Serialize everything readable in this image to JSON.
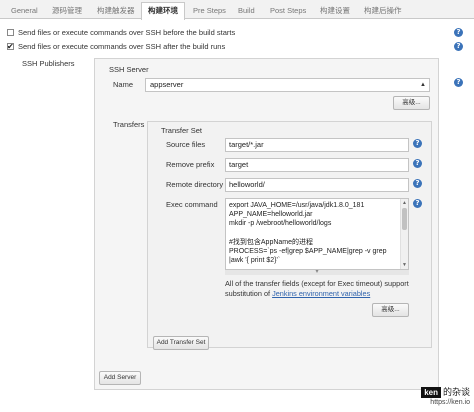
{
  "tabs": [
    "General",
    "源码管理",
    "构建触发器",
    "构建环境",
    "Pre Steps",
    "Build",
    "Post Steps",
    "构建设置",
    "构建后操作"
  ],
  "active_tab": "构建环境",
  "options": {
    "before_label": "Send files or execute commands over SSH before the build starts",
    "after_label": "Send files or execute commands over SSH after the build runs"
  },
  "ssh_publishers_label": "SSH Publishers",
  "ssh_server": {
    "section_label": "SSH Server",
    "name_label": "Name",
    "name_value": "appserver",
    "advanced_label": "高级..."
  },
  "transfers": {
    "label": "Transfers",
    "transfer_set_label": "Transfer Set",
    "source_files_label": "Source files",
    "source_files_value": "target/*.jar",
    "remove_prefix_label": "Remove prefix",
    "remove_prefix_value": "target",
    "remote_directory_label": "Remote directory",
    "remote_directory_value": "helloworld/",
    "exec_command_label": "Exec command",
    "exec_command_lines": [
      "export JAVA_HOME=/usr/java/jdk1.8.0_181",
      "APP_NAME=helloworld.jar",
      "mkdir -p /webroot/helloworld/logs",
      "",
      "#找到包含AppName的进程",
      "PROCESS=`ps -ef|grep $APP_NAME|grep -v grep",
      "|awk '{ print $2}'`"
    ],
    "note_prefix": "All of the transfer fields (except for Exec timeout) support substitution of ",
    "note_link": "Jenkins environment variables",
    "advanced_label": "高级...",
    "add_transfer_set_label": "Add Transfer Set"
  },
  "add_server_label": "Add Server",
  "watermark": {
    "badge": "ken",
    "text": "的杂谈",
    "url": "https://ken.io"
  },
  "colors": {
    "help_icon": "#3b73b9",
    "link": "#2f63ad"
  }
}
